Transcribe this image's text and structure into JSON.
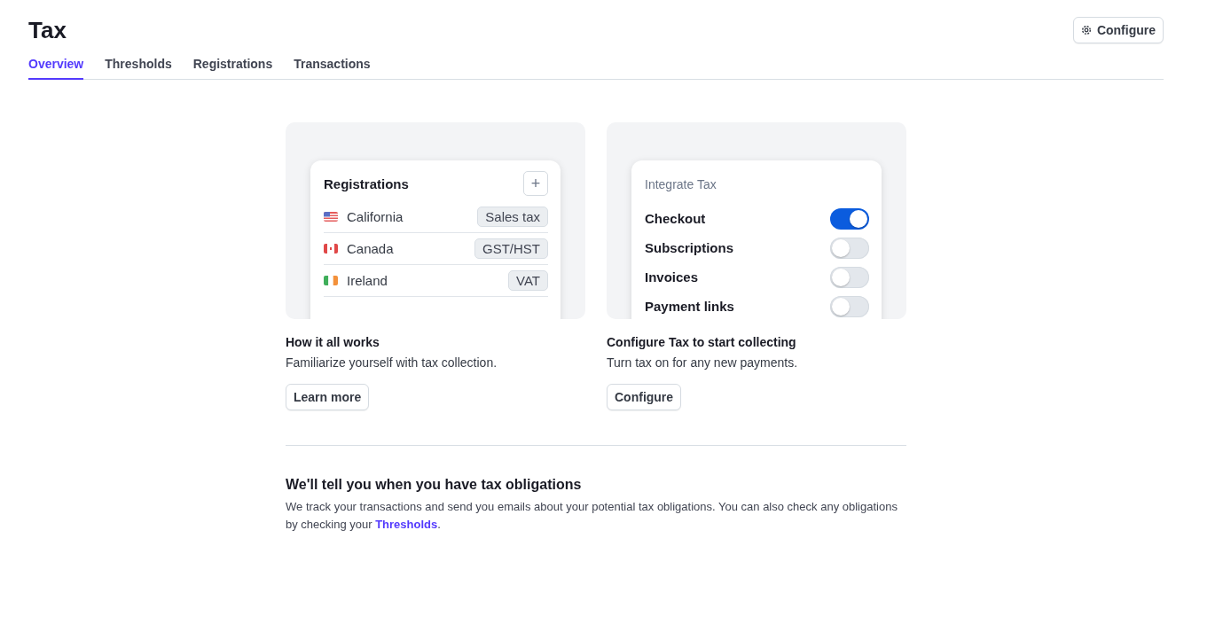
{
  "page": {
    "title": "Tax",
    "configure_button": "Configure"
  },
  "tabs": [
    {
      "label": "Overview",
      "selected": true
    },
    {
      "label": "Thresholds",
      "selected": false
    },
    {
      "label": "Registrations",
      "selected": false
    },
    {
      "label": "Transactions",
      "selected": false
    }
  ],
  "cards": [
    {
      "kind": "registrations",
      "illustration": {
        "title": "Registrations",
        "add_button": "+",
        "rows": [
          {
            "kind": "us",
            "name": "California",
            "tag": "Sales tax"
          },
          {
            "kind": "ca",
            "name": "Canada",
            "tag": "GST/HST"
          },
          {
            "kind": "ie",
            "name": "Ireland",
            "tag": "VAT"
          }
        ]
      },
      "title": "How it all works",
      "description": "Familiarize yourself with tax collection.",
      "button": "Learn more"
    },
    {
      "kind": "integrate",
      "illustration": {
        "title": "Integrate Tax",
        "rows": [
          {
            "label": "Checkout",
            "on": true
          },
          {
            "label": "Subscriptions",
            "on": false
          },
          {
            "label": "Invoices",
            "on": false
          },
          {
            "label": "Payment links",
            "on": false
          }
        ]
      },
      "title": "Configure Tax to start collecting",
      "description": "Turn tax on for any new payments.",
      "button": "Configure"
    }
  ],
  "notice": {
    "title": "We'll tell you when you have tax obligations",
    "text": "We track your transactions and send you emails about your potential tax obligations. You can also check any obligations by checking your",
    "link": "Thresholds",
    "after": "."
  }
}
